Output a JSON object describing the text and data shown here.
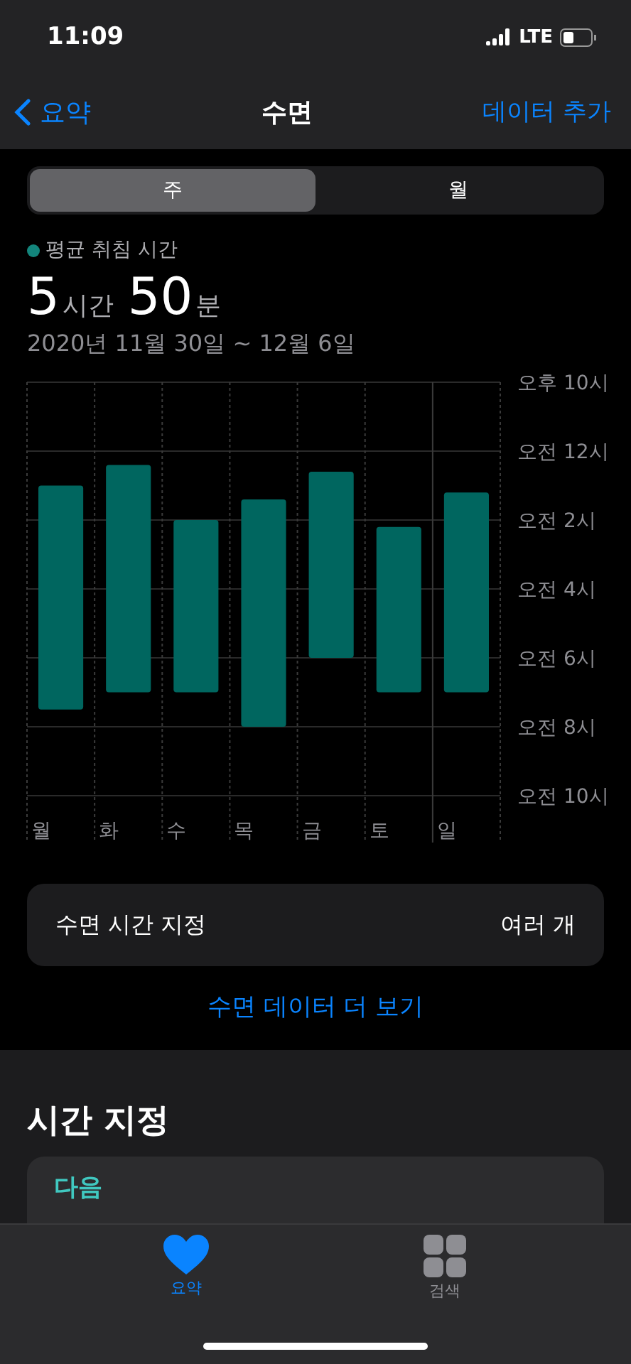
{
  "status_bar": {
    "time": "11:09",
    "network": "LTE"
  },
  "nav": {
    "back": "요약",
    "title": "수면",
    "action": "데이터 추가"
  },
  "segments": [
    {
      "label": "주",
      "selected": true
    },
    {
      "label": "월",
      "selected": false
    }
  ],
  "summary": {
    "legend": {
      "label": "평균 취침 시간",
      "color": "#13857c"
    },
    "hours": "5",
    "hours_unit": "시간",
    "minutes": "50",
    "minutes_unit": "분",
    "range": "2020년 11월 30일 ~ 12월 6일"
  },
  "sleep_chart": {
    "days": [
      "월",
      "화",
      "수",
      "목",
      "금",
      "토",
      "일"
    ],
    "time_labels": [
      "오후 10시",
      "오전 12시",
      "오전 2시",
      "오전 4시",
      "오전 6시",
      "오전 8시",
      "오전 10시"
    ]
  },
  "schedule_row": {
    "label": "수면 시간 지정",
    "value": "여러 개"
  },
  "more_link": "수면 데이터 더 보기",
  "section": {
    "title": "시간 지정",
    "card_label": "다음"
  },
  "tab_bar": [
    {
      "label": "요약",
      "selected": true,
      "kind": "heart"
    },
    {
      "label": "검색",
      "selected": false,
      "kind": "grid"
    }
  ]
}
